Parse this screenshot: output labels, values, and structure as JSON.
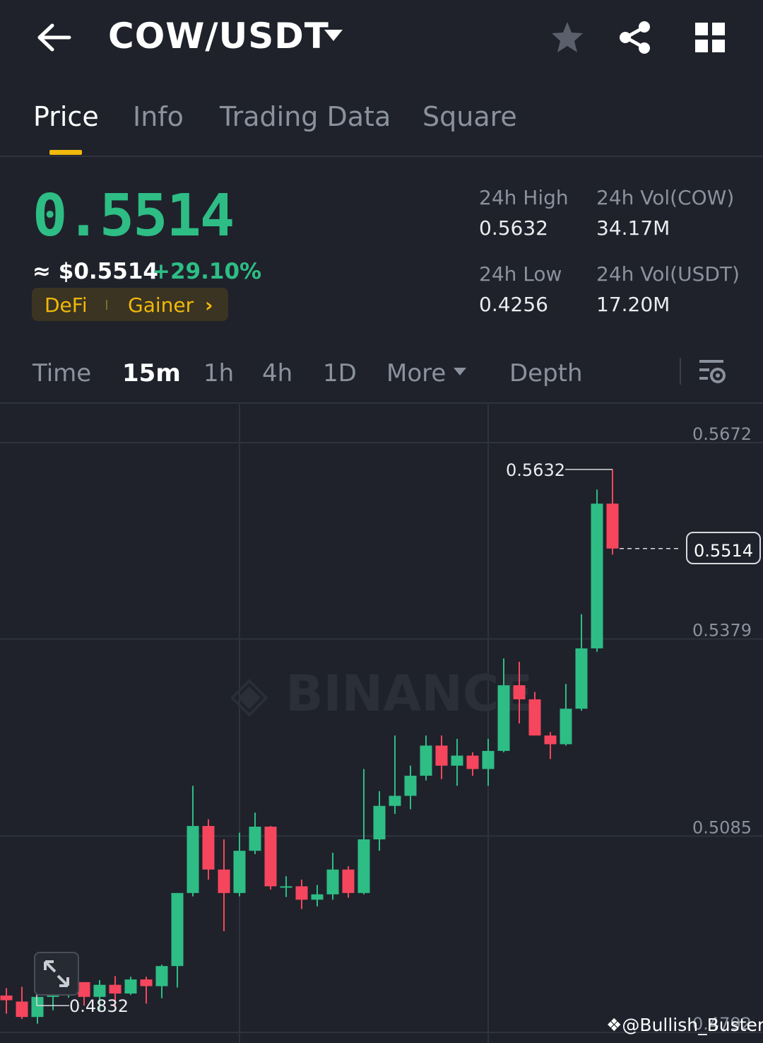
{
  "header": {
    "pair": "COW/USDT",
    "icons": {
      "back": "arrow-left-icon",
      "pair_menu": "caret-down-icon",
      "favorite": "star-icon",
      "share": "share-icon",
      "more": "grid-icon"
    }
  },
  "tabs": [
    {
      "label": "Price",
      "active": true
    },
    {
      "label": "Info",
      "active": false
    },
    {
      "label": "Trading Data",
      "active": false
    },
    {
      "label": "Square",
      "active": false
    }
  ],
  "ticker": {
    "last_price": "0.5514",
    "usd_price": "≈ $0.5514",
    "change": "+29.10%",
    "tags": [
      "DeFi",
      "Gainer"
    ],
    "stats": [
      {
        "label": "24h High",
        "value": "0.5632"
      },
      {
        "label": "24h Vol(COW)",
        "value": "34.17M"
      },
      {
        "label": "24h Low",
        "value": "0.4256"
      },
      {
        "label": "24h Vol(USDT)",
        "value": "17.20M"
      }
    ]
  },
  "timeframes": {
    "items": [
      "Time",
      "15m",
      "1h",
      "4h",
      "1D",
      "More",
      "Depth"
    ],
    "active": "15m"
  },
  "colors": {
    "up": "#2ebd85",
    "down": "#f6465d",
    "accent": "#f0b90b",
    "background": "#1f222b"
  },
  "chart_data": {
    "type": "candlestick",
    "y_axis_ticks": [
      "0.5672",
      "0.5379",
      "0.5085",
      "0.4792"
    ],
    "ylim": [
      0.4792,
      0.5672
    ],
    "current_price_label": "0.5514",
    "high_marker": "0.5632",
    "low_marker": "0.4832",
    "watermark": "BINANCE",
    "candles": [
      {
        "o": 0.4847,
        "h": 0.4858,
        "l": 0.482,
        "c": 0.484
      },
      {
        "o": 0.4838,
        "h": 0.486,
        "l": 0.4812,
        "c": 0.4815
      },
      {
        "o": 0.4815,
        "h": 0.4845,
        "l": 0.4805,
        "c": 0.4845
      },
      {
        "o": 0.4845,
        "h": 0.487,
        "l": 0.4825,
        "c": 0.4867
      },
      {
        "o": 0.4867,
        "h": 0.487,
        "l": 0.4844,
        "c": 0.4867
      },
      {
        "o": 0.4867,
        "h": 0.4867,
        "l": 0.4832,
        "c": 0.4845
      },
      {
        "o": 0.4845,
        "h": 0.487,
        "l": 0.4824,
        "c": 0.4863
      },
      {
        "o": 0.4863,
        "h": 0.4876,
        "l": 0.483,
        "c": 0.485
      },
      {
        "o": 0.485,
        "h": 0.4875,
        "l": 0.4848,
        "c": 0.4871
      },
      {
        "o": 0.4871,
        "h": 0.4875,
        "l": 0.4835,
        "c": 0.4861
      },
      {
        "o": 0.4861,
        "h": 0.4893,
        "l": 0.4843,
        "c": 0.4891
      },
      {
        "o": 0.4891,
        "h": 0.5,
        "l": 0.4859,
        "c": 0.5
      },
      {
        "o": 0.5,
        "h": 0.516,
        "l": 0.4995,
        "c": 0.51
      },
      {
        "o": 0.51,
        "h": 0.511,
        "l": 0.502,
        "c": 0.5035
      },
      {
        "o": 0.5035,
        "h": 0.508,
        "l": 0.4943,
        "c": 0.5
      },
      {
        "o": 0.5,
        "h": 0.509,
        "l": 0.4995,
        "c": 0.5063
      },
      {
        "o": 0.5063,
        "h": 0.512,
        "l": 0.5058,
        "c": 0.5099
      },
      {
        "o": 0.5099,
        "h": 0.51,
        "l": 0.5005,
        "c": 0.501
      },
      {
        "o": 0.501,
        "h": 0.5025,
        "l": 0.4994,
        "c": 0.501
      },
      {
        "o": 0.501,
        "h": 0.502,
        "l": 0.4976,
        "c": 0.499
      },
      {
        "o": 0.499,
        "h": 0.5012,
        "l": 0.498,
        "c": 0.4998
      },
      {
        "o": 0.4998,
        "h": 0.506,
        "l": 0.499,
        "c": 0.5035
      },
      {
        "o": 0.5035,
        "h": 0.504,
        "l": 0.4993,
        "c": 0.5
      },
      {
        "o": 0.5,
        "h": 0.5185,
        "l": 0.4998,
        "c": 0.508
      },
      {
        "o": 0.508,
        "h": 0.5152,
        "l": 0.5063,
        "c": 0.513
      },
      {
        "o": 0.513,
        "h": 0.5235,
        "l": 0.5118,
        "c": 0.5145
      },
      {
        "o": 0.5145,
        "h": 0.519,
        "l": 0.5125,
        "c": 0.5175
      },
      {
        "o": 0.5175,
        "h": 0.5235,
        "l": 0.5168,
        "c": 0.522
      },
      {
        "o": 0.522,
        "h": 0.5235,
        "l": 0.517,
        "c": 0.519
      },
      {
        "o": 0.519,
        "h": 0.523,
        "l": 0.516,
        "c": 0.5205
      },
      {
        "o": 0.5205,
        "h": 0.521,
        "l": 0.5175,
        "c": 0.5185
      },
      {
        "o": 0.5185,
        "h": 0.523,
        "l": 0.516,
        "c": 0.5212
      },
      {
        "o": 0.5212,
        "h": 0.535,
        "l": 0.521,
        "c": 0.531
      },
      {
        "o": 0.531,
        "h": 0.5345,
        "l": 0.5253,
        "c": 0.5289
      },
      {
        "o": 0.5289,
        "h": 0.53,
        "l": 0.5235,
        "c": 0.5235
      },
      {
        "o": 0.5235,
        "h": 0.524,
        "l": 0.52,
        "c": 0.5222
      },
      {
        "o": 0.5222,
        "h": 0.5312,
        "l": 0.522,
        "c": 0.5275
      },
      {
        "o": 0.5275,
        "h": 0.5416,
        "l": 0.5272,
        "c": 0.5365
      },
      {
        "o": 0.5365,
        "h": 0.5602,
        "l": 0.536,
        "c": 0.5581
      },
      {
        "o": 0.5581,
        "h": 0.5632,
        "l": 0.5505,
        "c": 0.5514
      }
    ]
  },
  "footer": {
    "credit": "@Bullish_Buster"
  }
}
